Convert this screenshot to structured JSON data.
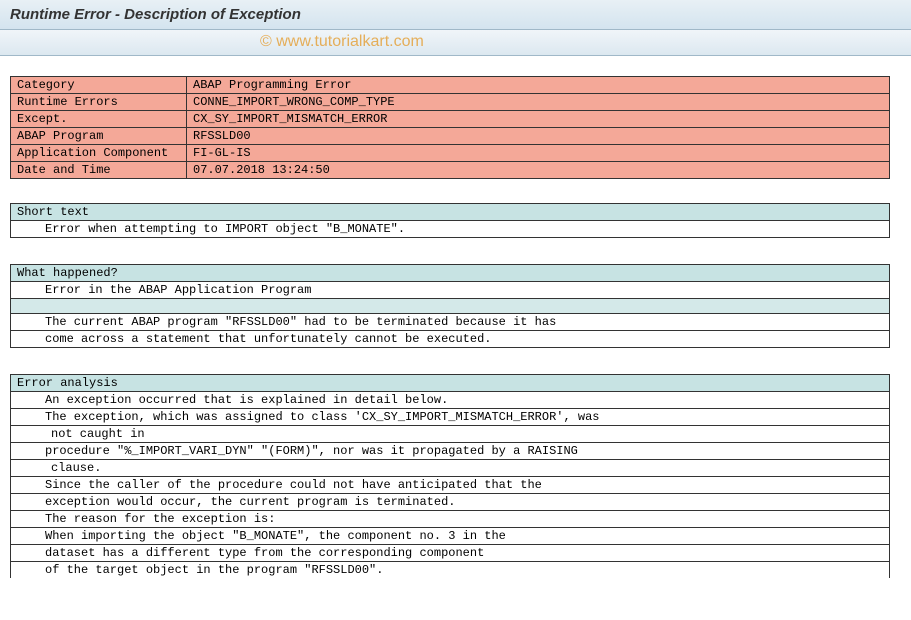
{
  "title": "Runtime Error - Description of Exception",
  "watermark": "© www.tutorialkart.com",
  "info": {
    "rows": [
      {
        "label": "Category",
        "value": "ABAP Programming Error"
      },
      {
        "label": "Runtime Errors",
        "value": "CONNE_IMPORT_WRONG_COMP_TYPE"
      },
      {
        "label": "Except.",
        "value": "CX_SY_IMPORT_MISMATCH_ERROR"
      },
      {
        "label": "ABAP Program",
        "value": "RFSSLD00"
      },
      {
        "label": "Application Component",
        "value": "FI-GL-IS"
      },
      {
        "label": "Date and Time",
        "value": "07.07.2018 13:24:50"
      }
    ]
  },
  "sections": {
    "short_text": {
      "header": "Short text",
      "lines": [
        {
          "text": "Error when attempting to IMPORT object \"B_MONATE\"."
        }
      ]
    },
    "what_happened": {
      "header": "What happened?",
      "lines": [
        {
          "text": "Error in the ABAP Application Program"
        },
        {
          "text": "",
          "blank": true
        },
        {
          "text": "The current ABAP program \"RFSSLD00\" had to be terminated because it has"
        },
        {
          "text": "come across a statement that unfortunately cannot be executed."
        }
      ]
    },
    "error_analysis": {
      "header": "Error analysis",
      "lines": [
        {
          "text": "An exception occurred that is explained in detail below."
        },
        {
          "text": "The exception, which was assigned to class 'CX_SY_IMPORT_MISMATCH_ERROR', was"
        },
        {
          "text": "not caught in",
          "extra": true
        },
        {
          "text": "procedure \"%_IMPORT_VARI_DYN\" \"(FORM)\", nor was it propagated by a RAISING"
        },
        {
          "text": "clause.",
          "extra": true
        },
        {
          "text": "Since the caller of the procedure could not have anticipated that the"
        },
        {
          "text": "exception would occur, the current program is terminated."
        },
        {
          "text": "The reason for the exception is:"
        },
        {
          "text": "When importing the object \"B_MONATE\", the component no. 3 in the"
        },
        {
          "text": "dataset has a different type from the corresponding component"
        },
        {
          "text": "of the target object in the program \"RFSSLD00\"."
        }
      ]
    }
  }
}
